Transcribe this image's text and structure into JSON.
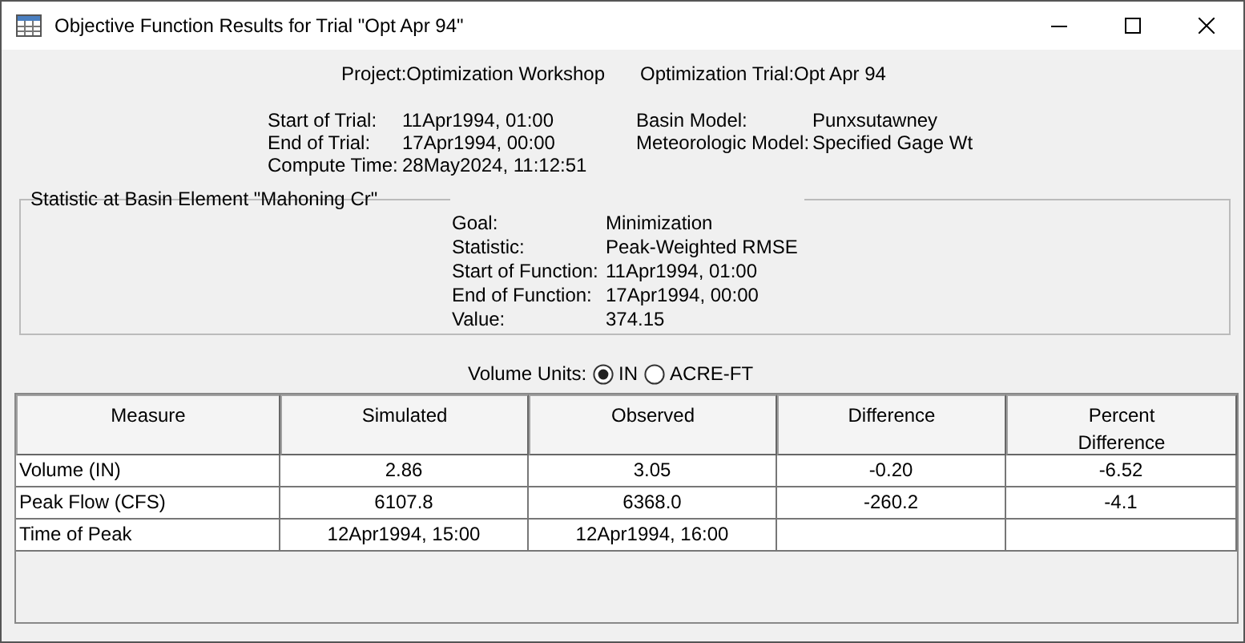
{
  "window": {
    "title": "Objective Function Results for Trial \"Opt Apr 94\""
  },
  "header": {
    "project_label": "Project:",
    "project": "Optimization Workshop",
    "trial_label": "Optimization Trial:",
    "trial": "Opt Apr 94"
  },
  "trial_info": [
    {
      "label": "Start of Trial:",
      "value": "11Apr1994, 01:00"
    },
    {
      "label": "End of Trial:",
      "value": "17Apr1994, 00:00"
    },
    {
      "label": "Compute Time:",
      "value": "28May2024, 11:12:51"
    }
  ],
  "model_info": [
    {
      "label": "Basin Model:",
      "value": "Punxsutawney"
    },
    {
      "label": "Meteorologic Model:",
      "value": "Specified Gage Wt"
    }
  ],
  "statistic_group": {
    "title": "Statistic at Basin Element \"Mahoning Cr\"",
    "rows": [
      {
        "label": "Goal:",
        "value": "Minimization"
      },
      {
        "label": "Statistic:",
        "value": "Peak-Weighted RMSE"
      },
      {
        "label": "Start of Function:",
        "value": "11Apr1994, 01:00"
      },
      {
        "label": "End of Function:",
        "value": "17Apr1994, 00:00"
      },
      {
        "label": "Value:",
        "value": "374.15"
      }
    ]
  },
  "volume_units": {
    "label": "Volume Units:",
    "options": [
      {
        "label": "IN",
        "selected": true
      },
      {
        "label": "ACRE-FT",
        "selected": false
      }
    ]
  },
  "table": {
    "columns": [
      "Measure",
      "Simulated",
      "Observed",
      "Difference",
      "Percent Difference"
    ],
    "rows": [
      [
        "Volume (IN)",
        "2.86",
        "3.05",
        "-0.20",
        "-6.52"
      ],
      [
        "Peak Flow (CFS)",
        "6107.8",
        "6368.0",
        "-260.2",
        "-4.1"
      ],
      [
        "Time of Peak",
        "12Apr1994, 15:00",
        "12Apr1994, 16:00",
        "",
        ""
      ]
    ]
  }
}
